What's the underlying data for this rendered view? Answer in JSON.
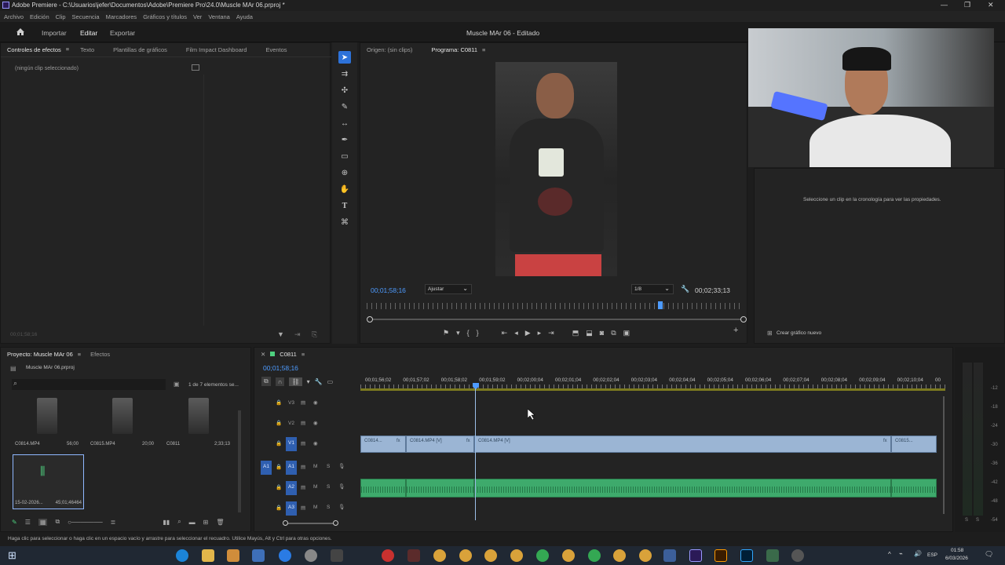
{
  "window": {
    "title": "Adobe Premiere - C:\\Usuarios\\jefer\\Documentos\\Adobe\\Premiere Pro\\24.0\\Muscle MAr 06.prproj *"
  },
  "menu": [
    "Archivo",
    "Edición",
    "Clip",
    "Secuencia",
    "Marcadores",
    "Gráficos y títulos",
    "Ver",
    "Ventana",
    "Ayuda"
  ],
  "workspace": {
    "tabs": [
      "Importar",
      "Editar",
      "Exportar"
    ],
    "active_tab": "Editar",
    "project_title": "Muscle MAr 06 - Editado"
  },
  "effects_panel": {
    "tabs": [
      "Controles de efectos",
      "Texto",
      "Plantillas de gráficos",
      "Film Impact Dashboard",
      "Eventos"
    ],
    "no_clip": "(ningún clip seleccionado)",
    "timecode": "00;01;58;16"
  },
  "program_monitor": {
    "source_tab": "Origen: (sin clips)",
    "program_tab": "Programa: C0811",
    "current_time": "00;01;58;16",
    "fit": "Ajustar",
    "resolution": "1/8",
    "duration": "00;02;33;13",
    "playhead_fraction": 0.78
  },
  "properties_panel": {
    "message": "Seleccione un clip en la cronología para ver las propiedades.",
    "create_button": "Crear gráfico nuevo"
  },
  "project_panel": {
    "tabs": [
      "Proyecto: Muscle MAr 06",
      "Efectos"
    ],
    "file": "Muscle MAr 06.prproj",
    "count": "1 de 7 elementos se...",
    "items": [
      {
        "name": "C0814.MP4",
        "duration": "56;00"
      },
      {
        "name": "C0815.MP4",
        "duration": "20;00"
      },
      {
        "name": "C0811",
        "duration": "2;33;13"
      },
      {
        "name": "15-02-2026...",
        "duration": "45;01;46464"
      }
    ]
  },
  "timeline": {
    "sequence": "C0811",
    "current_time": "00;01;58;16",
    "ruler": [
      "00;01;56;02",
      "00;01;57;02",
      "00;01;58;02",
      "00;01;59;02",
      "00;02;00;04",
      "00;02;01;04",
      "00;02;02;04",
      "00;02;03;04",
      "00;02;04;04",
      "00;02;05;04",
      "00;02;06;04",
      "00;02;07;04",
      "00;02;08;04",
      "00;02;09;04",
      "00;02;10;04",
      "00"
    ],
    "video_tracks": [
      "V3",
      "V2",
      "V1"
    ],
    "audio_tracks": [
      "A1",
      "A2",
      "A3"
    ],
    "clips_v1": [
      "C0814...",
      "C0814.MP4 [V]",
      "C0814.MP4 [V]",
      "C0815..."
    ],
    "fx": "fx"
  },
  "status": {
    "hint": "Haga clic para seleccionar o haga clic en un espacio vacío y arrastre para seleccionar el recuadro. Utilice Mayús, Alt y Ctrl para otras opciones."
  },
  "taskbar": {
    "lang": "ESP",
    "time": "01:58",
    "date": "6/03/2026"
  },
  "meter_scale": [
    "-12",
    "-18",
    "-24",
    "-30",
    "-36",
    "-42",
    "-48",
    "-54"
  ],
  "meter_letters": [
    "S",
    "S"
  ]
}
